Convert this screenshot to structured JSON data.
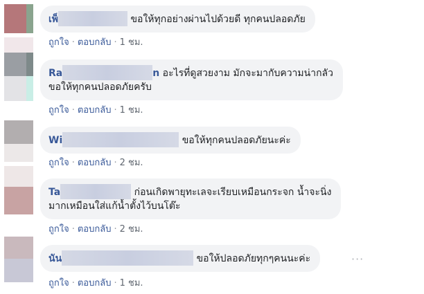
{
  "comments": [
    {
      "author": "เพ็",
      "text": "ขอให้ทุกอย่างผ่านไปด้วยดี ทุกคนปลอดภัย",
      "like": "ถูกใจ",
      "reply": "ตอบกลับ",
      "time": "1 ชม."
    },
    {
      "author": "Ra",
      "author_end": "n",
      "text": "อะไรที่ดูสวยงาม มักจะมากับความน่ากลัว",
      "text_line2": "ขอให้ทุกคนปลอดภัยครับ",
      "like": "ถูกใจ",
      "reply": "ตอบกลับ",
      "time": "1 ชม."
    },
    {
      "author": "Wi",
      "text": "ขอให้ทุกคนปลอดภัยนะค่ะ",
      "like": "ถูกใจ",
      "reply": "ตอบกลับ",
      "time": "2 ชม."
    },
    {
      "author": "Ta",
      "text": "ก่อนเกิดพายุทะเลจะเรียบเหมือนกระจก น้ำจะนิ่ง",
      "text_line2": "มากเหมือนใส่แก้น้ำตั้งไว้บนโต๊ะ",
      "like": "ถูกใจ",
      "reply": "ตอบกลับ",
      "time": "2 ชม."
    },
    {
      "author": "นัน",
      "text": "ขอให้ปลอดภัยทุกๆคนนะค่ะ",
      "like": "ถูกใจ",
      "reply": "ตอบกลับ",
      "time": "1 ชม.",
      "more": "···"
    }
  ],
  "colors": {
    "bubble": "#f2f3f5",
    "author": "#385898",
    "meta": "#606770"
  },
  "icons": {
    "more": "more-options-icon"
  }
}
